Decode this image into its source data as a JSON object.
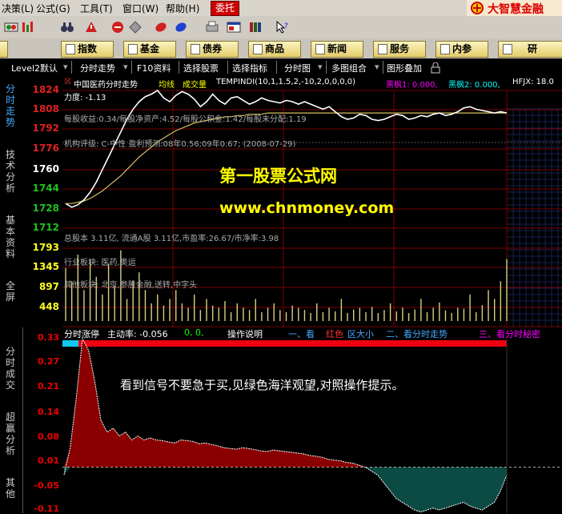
{
  "menubar": {
    "items": [
      "决策(L)",
      "公式(G)",
      "工具(T)",
      "窗口(W)",
      "帮助(H)"
    ],
    "entrust": "委托",
    "brand": "大智慧金融"
  },
  "toolbar": {
    "icons": [
      "quotes-icon",
      "binoculars-icon",
      "alert-icon",
      "diamond-icon",
      "chart-icon",
      "book-icon",
      "stamp-icon",
      "window-icon",
      "books-icon",
      "help-cursor-icon"
    ]
  },
  "navbar": {
    "buttons": [
      "指数",
      "基金",
      "债券",
      "商品",
      "新闻",
      "服务",
      "内参",
      "研"
    ]
  },
  "tabbar": {
    "items": [
      "Level2默认",
      "分时走势",
      "F10资料",
      "选择股票",
      "选择指标",
      "分时图",
      "多图组合",
      "图形叠加"
    ]
  },
  "lefttabs": {
    "items": [
      "分时走势",
      "技术分析",
      "基本资料",
      "全屏",
      "分时成交",
      "超赢分析",
      "其他"
    ]
  },
  "price_axis": {
    "labels": [
      {
        "text": "1824",
        "color": "#e02020"
      },
      {
        "text": "1808",
        "color": "#e02020"
      },
      {
        "text": "1792",
        "color": "#e02020"
      },
      {
        "text": "1776",
        "color": "#e02020"
      },
      {
        "text": "1760",
        "color": "#ffffff"
      },
      {
        "text": "1744",
        "color": "#20c020"
      },
      {
        "text": "1728",
        "color": "#20c020"
      },
      {
        "text": "1712",
        "color": "#20c020"
      }
    ]
  },
  "volume_axis": {
    "labels": [
      "1793",
      "1345",
      "897",
      "448"
    ]
  },
  "main_overlay": {
    "stock_title": "中国医药分时走势",
    "avg_line_label": "均线",
    "volume_label": "成交量",
    "formula": "TEMPINDI(10,1,1.5,2,-10,2,0,0,0,0)",
    "hf1": "黑枫1: 0.000,",
    "hf2": "黑枫2: 0.000,",
    "hfjx": "HFJX: 18.0",
    "force": "力度:  -1.13",
    "eps_line": "每股收益:0.34/每股净资产:4.52/每股公积金:1.42/每股未分配:1.19",
    "rating_line": "机构评级: C-中性  盈利预测:08年0.56;09年0.67;  (2008-07-29)",
    "capital_line": "总股本 3.11亿, 流通A股 3.11亿,市盈率:26.67/市净率:3.98",
    "industry_line": "行业板块: 医药,奥运",
    "other_line": "其他板块: 北京,参股金融,送转,中字头",
    "watermark_cn": "第一股票公式网",
    "watermark_url": "www.chnmoney.com"
  },
  "lower_overlay": {
    "indicator_label": "分时涨停",
    "active_rate": "主动率: -0.056",
    "zeros": "0,  0,",
    "ops_label": "操作说明",
    "tip1_num": "一、看",
    "tip1_red": "红色",
    "tip1_rest": "区大小",
    "tip2": "二、看分时走势",
    "tip3": "三、看分时秘密",
    "advice": "看到信号不要急于买,见绿色海洋观望,对照操作提示。"
  },
  "lower_axis": {
    "labels": [
      "0.33",
      "0.27",
      "0.21",
      "0.14",
      "0.08",
      "0.01",
      "-0.05",
      "-0.11"
    ]
  },
  "chart_data": {
    "type": "line",
    "price_series": {
      "name": "分时走势",
      "values": [
        1731,
        1728,
        1730,
        1734,
        1740,
        1748,
        1758,
        1768,
        1778,
        1788,
        1798,
        1806,
        1812,
        1816,
        1818,
        1821,
        1815,
        1812,
        1817,
        1820,
        1818,
        1814,
        1808,
        1812,
        1818,
        1813,
        1810,
        1815,
        1816,
        1813,
        1810,
        1812,
        1815,
        1813,
        1812,
        1811,
        1813,
        1812,
        1810,
        1812,
        1810,
        1808,
        1806,
        1808,
        1804,
        1800,
        1798,
        1799,
        1802,
        1801,
        1798,
        1797,
        1798,
        1800,
        1802,
        1801,
        1798,
        1799,
        1801,
        1800,
        1802,
        1803,
        1801,
        1802,
        1804,
        1807,
        1808,
        1806,
        1805,
        1804,
        1803,
        1804,
        1803
      ],
      "ylim": [
        1712,
        1826
      ]
    },
    "avg_series": {
      "name": "均线",
      "values": [
        1731,
        1731,
        1732,
        1733,
        1735,
        1738,
        1741,
        1745,
        1749,
        1753,
        1758,
        1763,
        1768,
        1772,
        1776,
        1780,
        1783,
        1786,
        1789,
        1791,
        1793,
        1795,
        1796,
        1797,
        1798,
        1799,
        1800,
        1800,
        1801,
        1801,
        1802,
        1802,
        1802,
        1803,
        1803,
        1803,
        1803,
        1803,
        1803,
        1803,
        1803,
        1803,
        1803,
        1803,
        1803,
        1803,
        1803,
        1803,
        1803,
        1803,
        1803,
        1803,
        1803,
        1803,
        1803,
        1803,
        1803,
        1803,
        1803,
        1803,
        1803,
        1803,
        1803,
        1803,
        1803,
        1803,
        1803,
        1803,
        1803,
        1803,
        1803,
        1803,
        1803
      ],
      "ylim": [
        1712,
        1826
      ]
    },
    "volume_series": {
      "name": "成交量",
      "values": [
        1200,
        900,
        1500,
        700,
        1400,
        1000,
        600,
        1300,
        800,
        1600,
        500,
        900,
        1100,
        700,
        400,
        600,
        350,
        500,
        700,
        400,
        300,
        600,
        250,
        500,
        350,
        300,
        450,
        200,
        400,
        300,
        250,
        500,
        200,
        300,
        400,
        250,
        200,
        350,
        300,
        250,
        180,
        400,
        200,
        300,
        220,
        500,
        180,
        260,
        300,
        200,
        320,
        180,
        250,
        400,
        220,
        300,
        180,
        260,
        500,
        200,
        300,
        420,
        240,
        180,
        300,
        280,
        600,
        200,
        360,
        700,
        500,
        900,
        1400
      ],
      "ylim": [
        0,
        1900
      ]
    },
    "indicator_series": {
      "name": "分时涨停",
      "values": [
        -0.02,
        0.05,
        0.18,
        0.33,
        0.3,
        0.22,
        0.12,
        0.09,
        0.1,
        0.08,
        0.09,
        0.07,
        0.08,
        0.07,
        0.075,
        0.07,
        0.068,
        0.065,
        0.062,
        0.07,
        0.068,
        0.066,
        0.06,
        0.062,
        0.058,
        0.055,
        0.05,
        0.048,
        0.046,
        0.05,
        0.048,
        0.045,
        0.042,
        0.04,
        0.044,
        0.042,
        0.04,
        0.038,
        0.036,
        0.034,
        0.03,
        0.028,
        0.025,
        0.02,
        0.018,
        0.016,
        0.012,
        0.01,
        0.005,
        0.0,
        -0.01,
        -0.02,
        -0.04,
        -0.06,
        -0.08,
        -0.09,
        -0.1,
        -0.11,
        -0.115,
        -0.11,
        -0.105,
        -0.11,
        -0.105,
        -0.1,
        -0.095,
        -0.09,
        -0.1,
        -0.105,
        -0.11,
        -0.1,
        -0.09,
        -0.06,
        -0.02
      ],
      "ylim": [
        -0.11,
        0.33
      ]
    }
  }
}
